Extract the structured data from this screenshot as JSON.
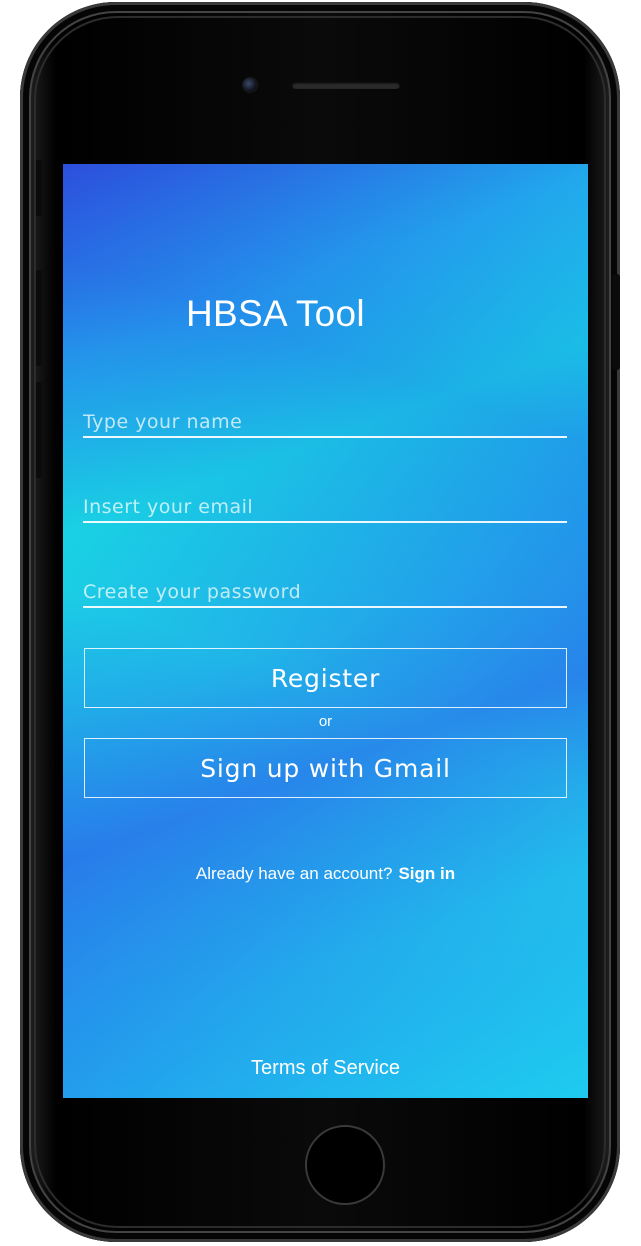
{
  "app": {
    "title": "HBSA Tool"
  },
  "form": {
    "name_placeholder": "Type your name",
    "email_placeholder": "Insert your email",
    "password_placeholder": "Create your password",
    "name_value": "",
    "email_value": "",
    "password_value": ""
  },
  "actions": {
    "register_label": "Register",
    "or_label": "or",
    "gmail_label": "Sign up with Gmail"
  },
  "footer": {
    "account_prompt": "Already have an account?",
    "signin_label": "Sign in",
    "terms_label": "Terms of Service"
  },
  "colors": {
    "gradient_blue": "#1f6ae8",
    "gradient_cyan": "#19d3e6",
    "text": "#ffffff",
    "device_frame": "#000000"
  },
  "icons": {
    "camera": "front-camera-icon",
    "speaker": "earpiece-speaker-icon",
    "home": "home-button-icon"
  }
}
